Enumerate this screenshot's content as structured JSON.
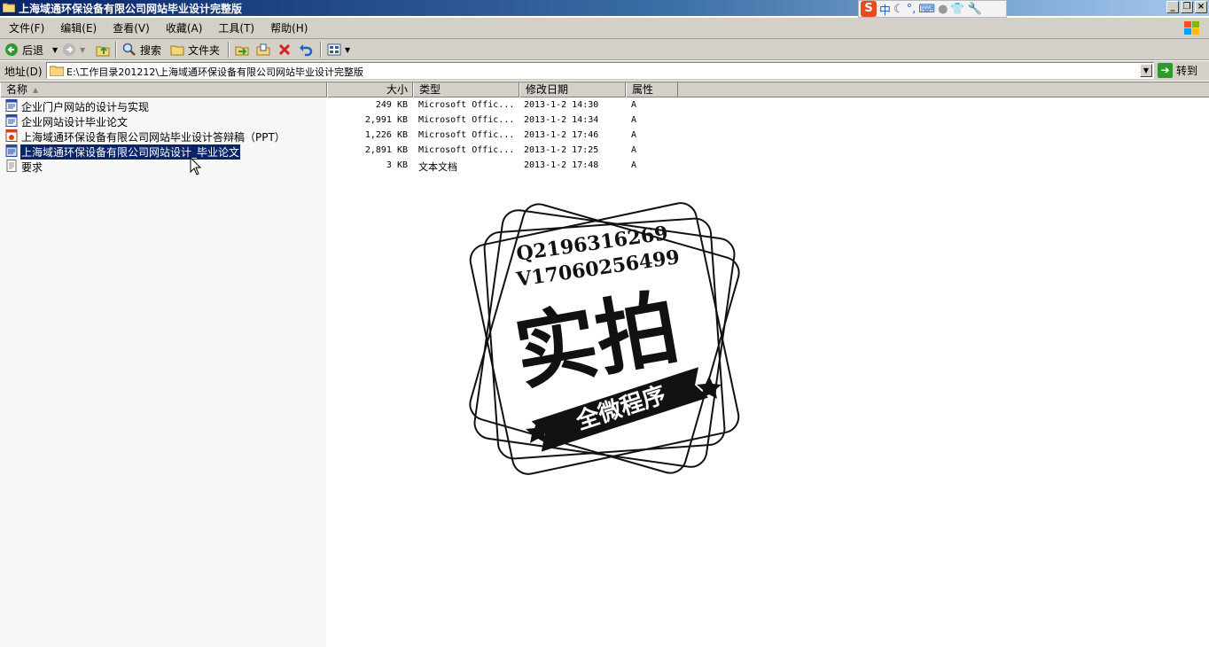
{
  "window": {
    "title": "上海域通环保设备有限公司网站毕业设计完整版",
    "controls": [
      "_",
      "❐",
      "×"
    ]
  },
  "ime": {
    "logo": "S",
    "mode": "中"
  },
  "menu": [
    {
      "label": "文件(F)"
    },
    {
      "label": "编辑(E)"
    },
    {
      "label": "查看(V)"
    },
    {
      "label": "收藏(A)"
    },
    {
      "label": "工具(T)"
    },
    {
      "label": "帮助(H)"
    }
  ],
  "toolbar": {
    "back_label": "后退",
    "search_label": "搜索",
    "folders_label": "文件夹"
  },
  "address": {
    "label": "地址(D)",
    "value": "E:\\工作目录201212\\上海域通环保设备有限公司网站毕业设计完整版",
    "go_label": "转到"
  },
  "columns": {
    "name": "名称",
    "size": "大小",
    "type": "类型",
    "modified": "修改日期",
    "attributes": "属性"
  },
  "files": [
    {
      "name": "企业门户网站的设计与实现",
      "size": "249 KB",
      "type": "Microsoft Offic...",
      "modified": "2013-1-2 14:30",
      "attr": "A",
      "icon": "word-doc-icon"
    },
    {
      "name": "企业网站设计毕业论文",
      "size": "2,991 KB",
      "type": "Microsoft Offic...",
      "modified": "2013-1-2 14:34",
      "attr": "A",
      "icon": "word-doc-icon"
    },
    {
      "name": "上海域通环保设备有限公司网站毕业设计答辩稿（PPT）",
      "size": "1,226 KB",
      "type": "Microsoft Offic...",
      "modified": "2013-1-2 17:46",
      "attr": "A",
      "icon": "powerpoint-icon"
    },
    {
      "name": "上海域通环保设备有限公司网站设计_毕业论文",
      "size": "2,891 KB",
      "type": "Microsoft Offic...",
      "modified": "2013-1-2 17:25",
      "attr": "A",
      "icon": "word-doc-icon",
      "selected": true
    },
    {
      "name": "要求",
      "size": "3 KB",
      "type": "文本文档",
      "modified": "2013-1-2 17:48",
      "attr": "A",
      "icon": "text-file-icon"
    }
  ],
  "watermark": {
    "line1": "Q2196316269",
    "line2": "V17060256499",
    "main": "实拍",
    "banner": "全微程序"
  }
}
